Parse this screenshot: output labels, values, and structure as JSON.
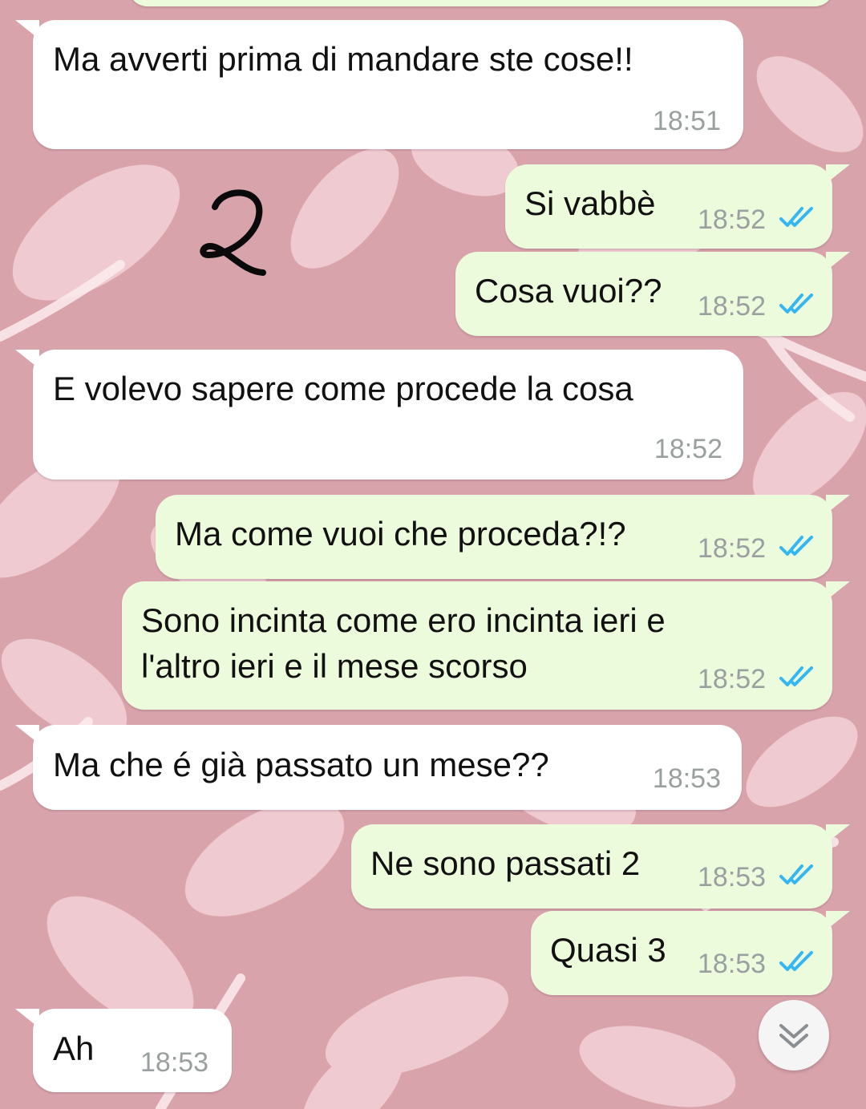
{
  "colors": {
    "wallpaper": "#d9a3ac",
    "incoming_bubble": "#ffffff",
    "outgoing_bubble": "#ecfbdc",
    "read_ticks": "#34b7f1",
    "timestamp": "#9aa0a0"
  },
  "messages": [
    {
      "direction": "incoming",
      "text": "Ma avverti prima di mandare ste cose!!",
      "time": "18:51"
    },
    {
      "direction": "outgoing",
      "text": "Si vabbè",
      "time": "18:52",
      "status": "read"
    },
    {
      "direction": "outgoing",
      "text": "Cosa vuoi??",
      "time": "18:52",
      "status": "read"
    },
    {
      "direction": "incoming",
      "text": "E volevo sapere come procede la cosa",
      "time": "18:52"
    },
    {
      "direction": "outgoing",
      "text": "Ma come vuoi che proceda?!?",
      "time": "18:52",
      "status": "read"
    },
    {
      "direction": "outgoing",
      "lines": [
        "Sono incinta come ero incinta ieri e",
        "l'altro ieri e il mese scorso"
      ],
      "time": "18:52",
      "status": "read"
    },
    {
      "direction": "incoming",
      "text": "Ma che é già passato un mese??",
      "time": "18:53"
    },
    {
      "direction": "outgoing",
      "text": "Ne sono passati 2",
      "time": "18:53",
      "status": "read"
    },
    {
      "direction": "outgoing",
      "text": "Quasi 3",
      "time": "18:53",
      "status": "read"
    },
    {
      "direction": "incoming",
      "text": "Ah",
      "time": "18:53"
    }
  ],
  "annotation": {
    "handwritten_mark": "2"
  },
  "icons": {
    "status": "double-check-icon",
    "scroll": "chevron-double-down-icon"
  }
}
